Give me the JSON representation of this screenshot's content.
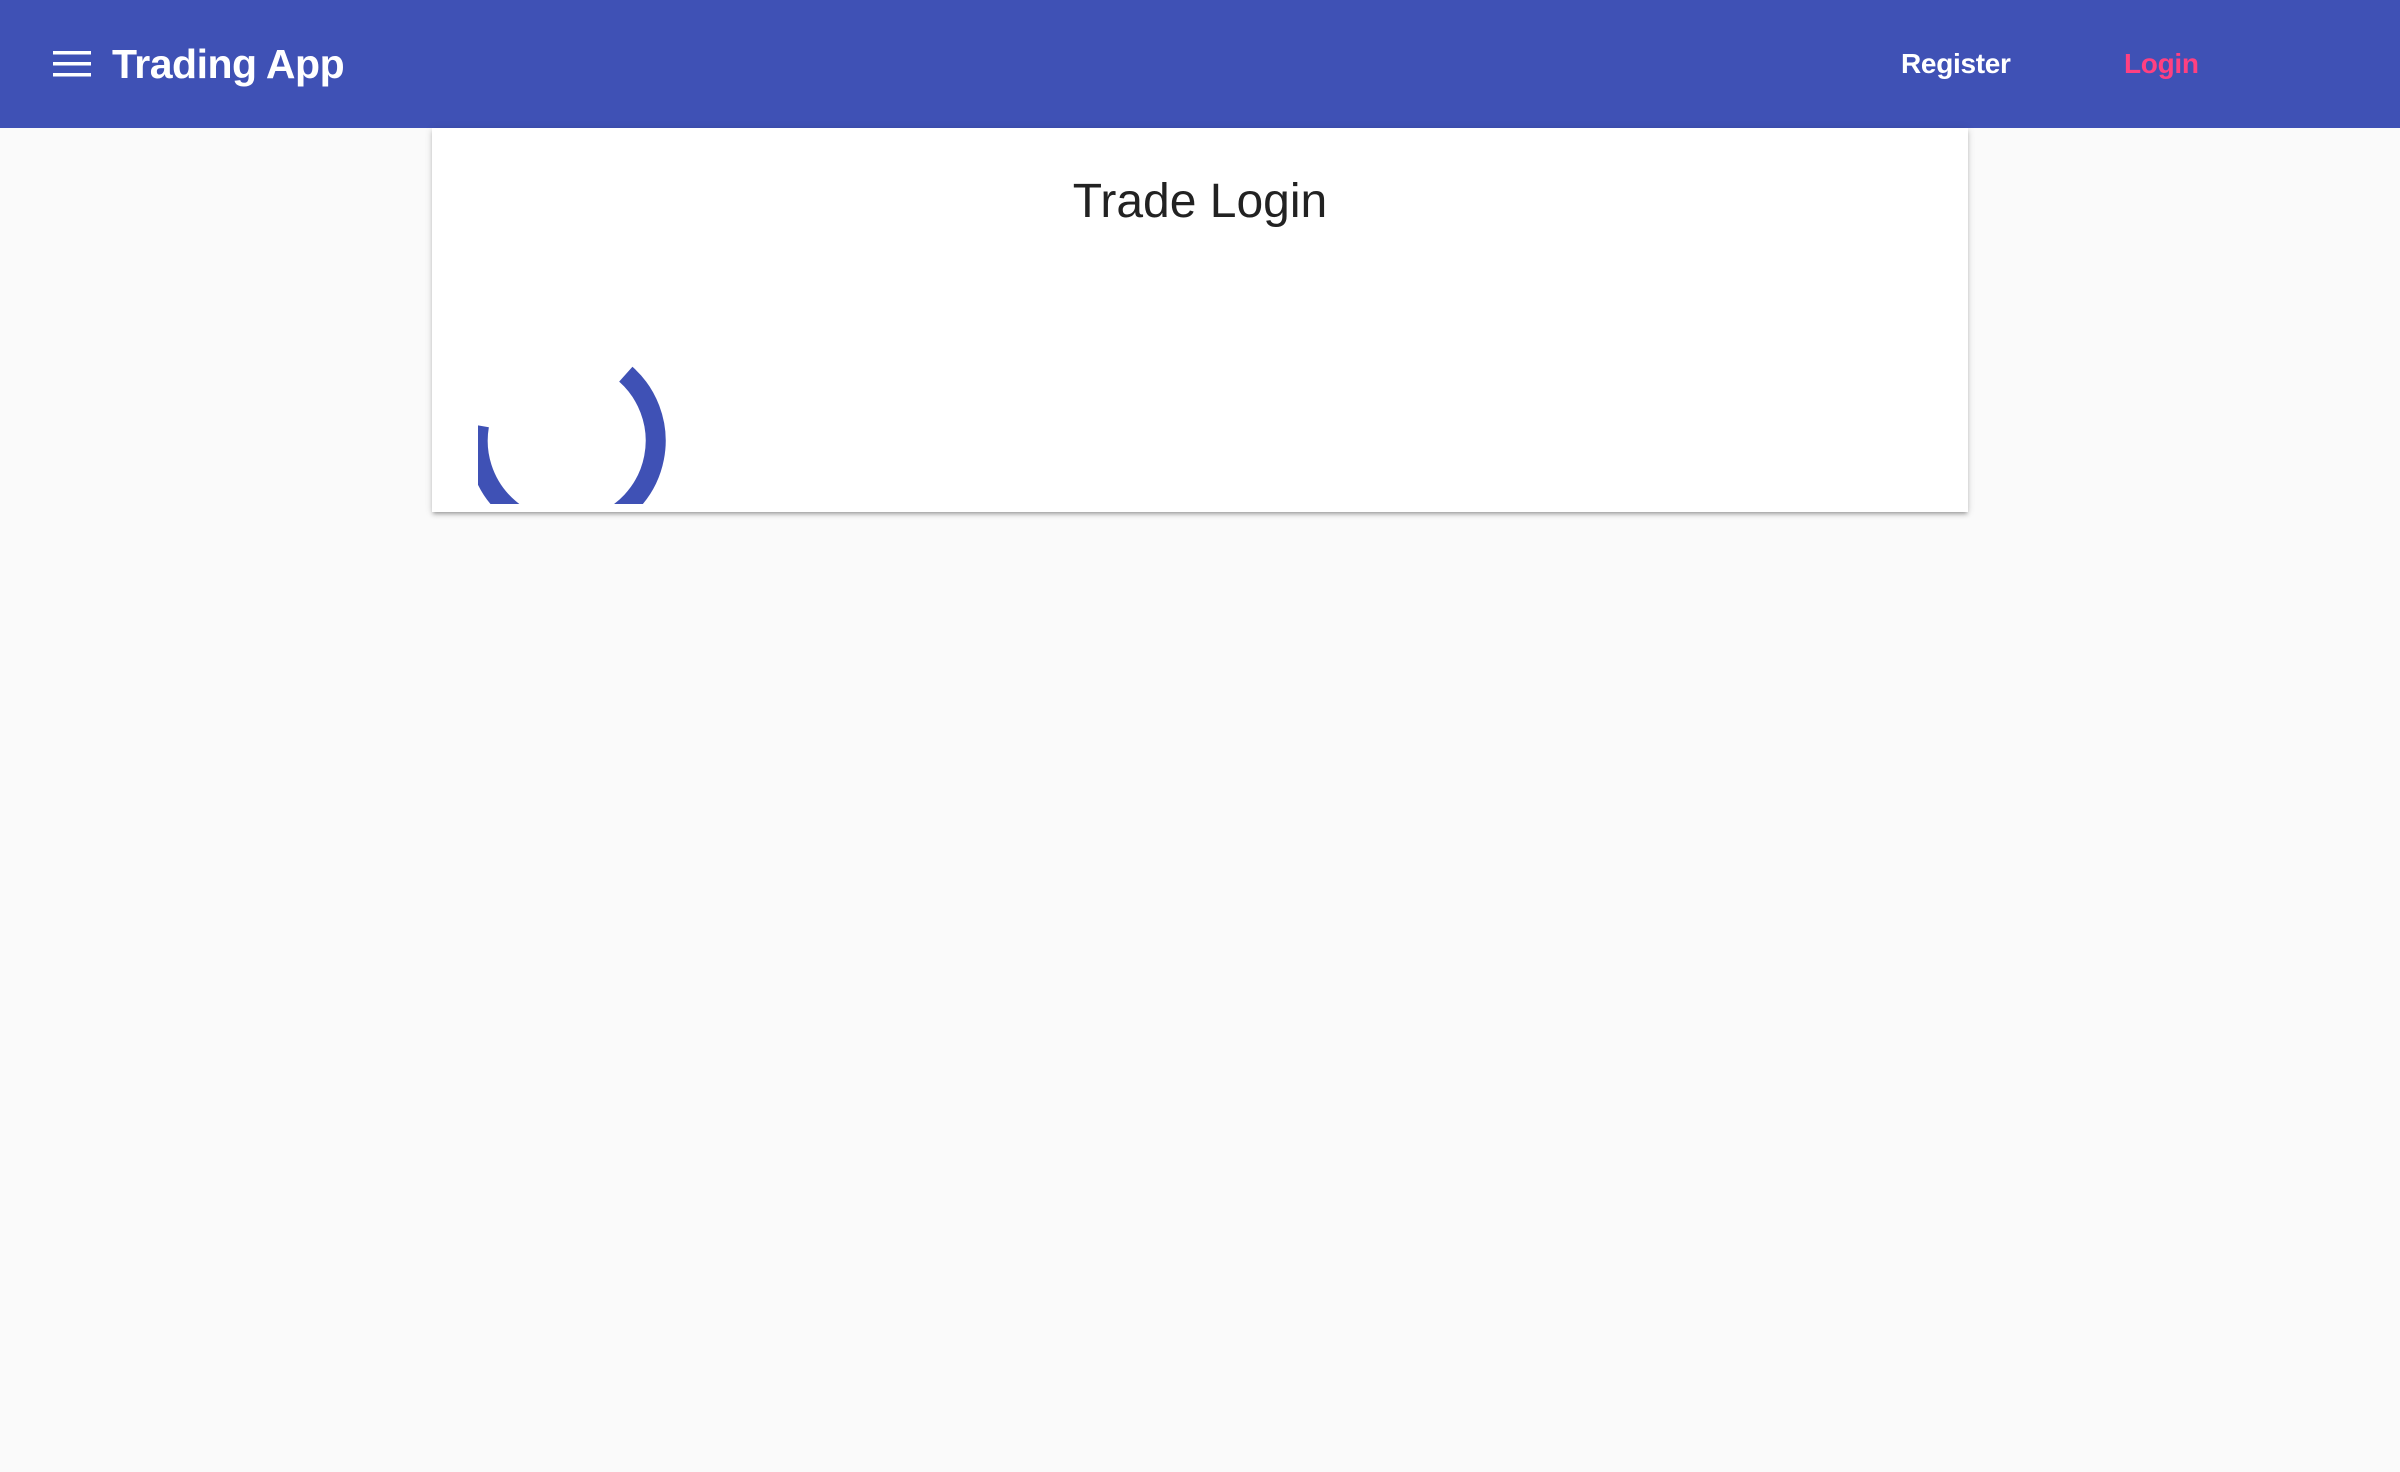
{
  "toolbar": {
    "menu_icon": "menu-icon",
    "title": "Trading App",
    "nav": {
      "register_label": "Register",
      "login_label": "Login"
    },
    "colors": {
      "background": "#3f51b5",
      "active_link": "#ff4081",
      "text": "#ffffff"
    }
  },
  "card": {
    "title": "Trade Login",
    "loading": true,
    "spinner_icon": "progress-spinner-icon",
    "spinner_color": "#3f51b5"
  }
}
